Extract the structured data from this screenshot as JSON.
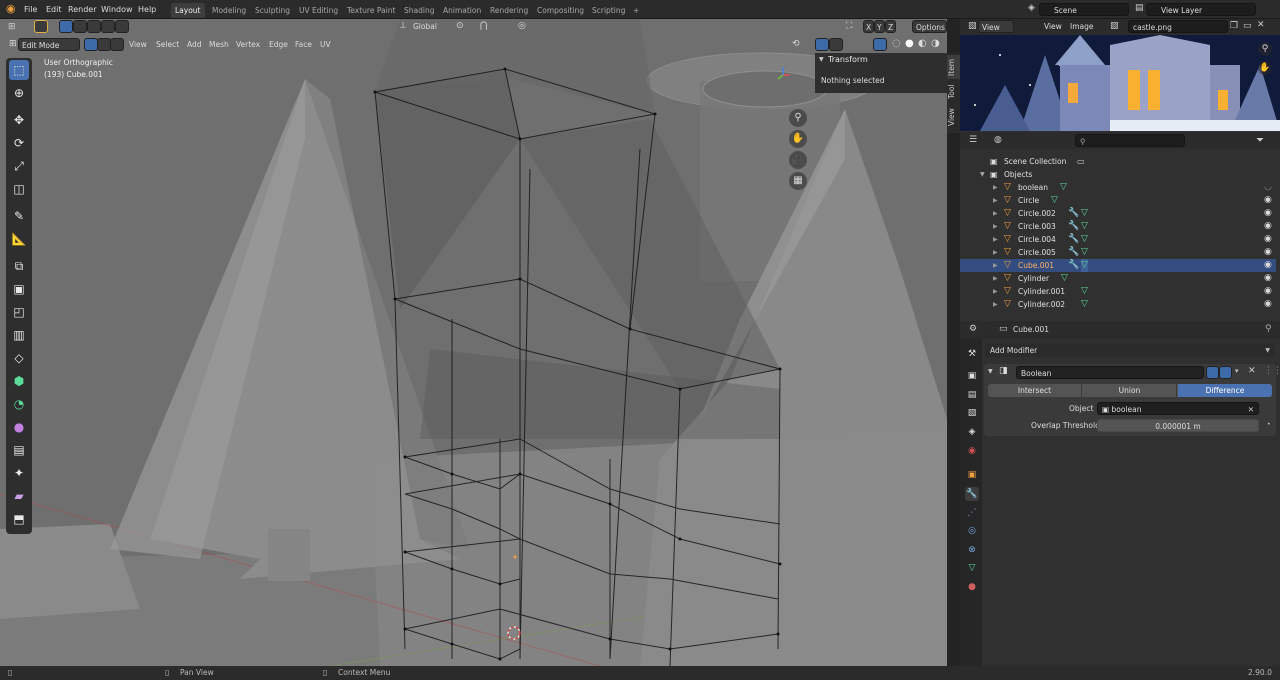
{
  "menus": [
    "File",
    "Edit",
    "Render",
    "Window",
    "Help"
  ],
  "workspaces": [
    "Layout",
    "Modeling",
    "Sculpting",
    "UV Editing",
    "Texture Paint",
    "Shading",
    "Animation",
    "Rendering",
    "Compositing",
    "Scripting",
    "+"
  ],
  "active_workspace": "Layout",
  "scene_field": "Scene",
  "view_layer_field": "View Layer",
  "viewport_header": {
    "mode": "Edit Mode",
    "menus": [
      "View",
      "Select",
      "Add",
      "Mesh",
      "Vertex",
      "Edge",
      "Face",
      "UV"
    ],
    "orientation": "Global",
    "axes": [
      "X",
      "Y",
      "Z"
    ],
    "options_label": "Options"
  },
  "viewport_info": {
    "line1": "User Orthographic",
    "line2": "(193) Cube.001"
  },
  "n_panel": {
    "section": "Transform",
    "message": "Nothing selected",
    "tabs": [
      "Item",
      "Tool",
      "View"
    ]
  },
  "image_editor": {
    "menus": [
      "View",
      "View",
      "Image"
    ],
    "image_name": "castle.png"
  },
  "outliner": {
    "rows": [
      {
        "name": "Scene Collection",
        "indent": 0
      },
      {
        "name": "Objects",
        "indent": 1
      },
      {
        "name": "boolean",
        "indent": 2,
        "selected": false
      },
      {
        "name": "Circle",
        "indent": 2,
        "selected": false
      },
      {
        "name": "Circle.002",
        "indent": 2,
        "selected": false
      },
      {
        "name": "Circle.003",
        "indent": 2,
        "selected": false
      },
      {
        "name": "Circle.004",
        "indent": 2,
        "selected": false
      },
      {
        "name": "Circle.005",
        "indent": 2,
        "selected": false
      },
      {
        "name": "Cube.001",
        "indent": 2,
        "selected": true
      },
      {
        "name": "Cylinder",
        "indent": 2,
        "selected": false
      },
      {
        "name": "Cylinder.001",
        "indent": 2,
        "selected": false
      },
      {
        "name": "Cylinder.002",
        "indent": 2,
        "selected": false
      }
    ]
  },
  "properties": {
    "object_name": "Cube.001",
    "add_modifier": "Add Modifier",
    "modifier_name": "Boolean",
    "operations": [
      "Intersect",
      "Union",
      "Difference"
    ],
    "active_operation": "Difference",
    "object_label": "Object",
    "object_value": "boolean",
    "threshold_label": "Overlap Threshold",
    "threshold_value": "0.000001 m"
  },
  "statusbar": {
    "pan": "Pan View",
    "context": "Context Menu",
    "version": "2.90.0"
  },
  "colors": {
    "accent": "#4a72b0",
    "selected_row": "#334d80",
    "active_op": "#4a72b0",
    "object_orange": "#f0a040",
    "mesh_green": "#5ddb9a"
  }
}
